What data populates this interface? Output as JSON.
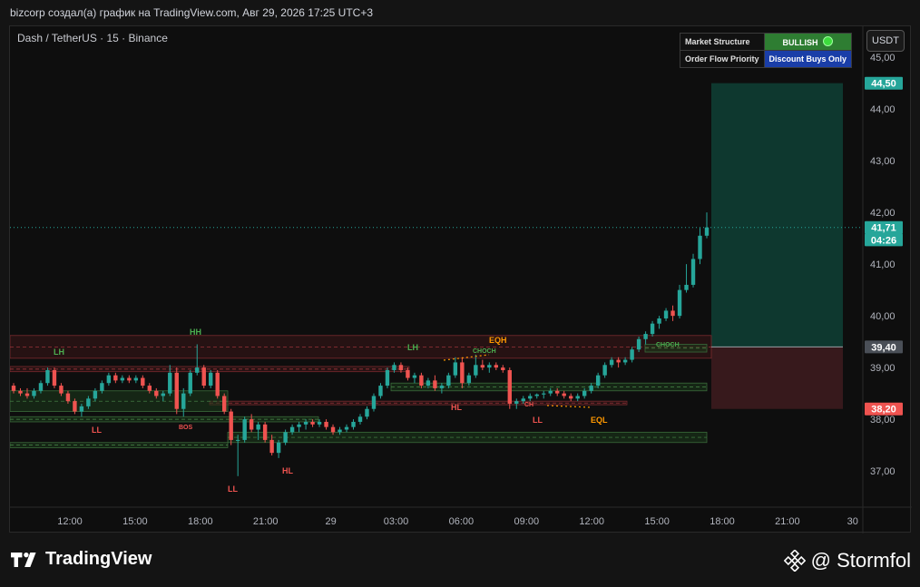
{
  "header": {
    "publish_line": "bizcorp создал(а) график на TradingView.com, Авг 29, 2026 17:25 UTC+3"
  },
  "chart": {
    "symbol_line": "Dash / TetherUS · 15 · Binance",
    "currency_button": "USDT",
    "market_structure": {
      "label": "Market Structure",
      "value": "BULLISH",
      "flow_label": "Order Flow Priority",
      "flow_value": "Discount Buys Only"
    },
    "colors": {
      "up": "#26a69a",
      "down": "#ef5350",
      "target_zone": "#0f3b32",
      "stop_zone": "#3a1a1e",
      "bull_zone": "#1b3a1b",
      "bear_zone": "#3a1518"
    }
  },
  "chart_data": {
    "type": "candlestick",
    "y_axis": {
      "ylim": [
        36.3,
        45.6
      ],
      "tick_labels": [
        "45,00",
        "44,00",
        "43,00",
        "42,00",
        "41,00",
        "40,00",
        "39,00",
        "38,00",
        "37,00"
      ],
      "tick_values": [
        45,
        44,
        43,
        42,
        41,
        40,
        39,
        38,
        37
      ]
    },
    "x_axis": {
      "tick_labels": [
        "12:00",
        "15:00",
        "18:00",
        "21:00",
        "29",
        "03:00",
        "06:00",
        "09:00",
        "12:00",
        "15:00",
        "18:00",
        "21:00",
        "30"
      ]
    },
    "price_labels": [
      {
        "text": "44,50",
        "value": 44.5,
        "kind": "target"
      },
      {
        "text": "41,71",
        "value": 41.71,
        "kind": "last"
      },
      {
        "text": "04:26",
        "value": 41.47,
        "kind": "countdown"
      },
      {
        "text": "39,40",
        "value": 39.4,
        "kind": "entry"
      },
      {
        "text": "38,20",
        "value": 38.2,
        "kind": "stop"
      }
    ],
    "structure_labels": [
      {
        "text": "LH",
        "kind": "bull"
      },
      {
        "text": "HH",
        "kind": "bull"
      },
      {
        "text": "LL",
        "kind": "bear"
      },
      {
        "text": "BOS",
        "kind": "bear"
      },
      {
        "text": "LL",
        "kind": "bear"
      },
      {
        "text": "HL",
        "kind": "bear"
      },
      {
        "text": "LH",
        "kind": "bull"
      },
      {
        "text": "CHOCH",
        "kind": "bull"
      },
      {
        "text": "EQH",
        "kind": "eq"
      },
      {
        "text": "HL",
        "kind": "bear"
      },
      {
        "text": "CH",
        "kind": "bear"
      },
      {
        "text": "LL",
        "kind": "bear"
      },
      {
        "text": "EQL",
        "kind": "eq"
      },
      {
        "text": "CHOCH",
        "kind": "bull"
      }
    ],
    "candles": [
      [
        38.65,
        38.7,
        38.5,
        38.55
      ],
      [
        38.55,
        38.6,
        38.45,
        38.5
      ],
      [
        38.5,
        38.6,
        38.4,
        38.45
      ],
      [
        38.45,
        38.6,
        38.4,
        38.55
      ],
      [
        38.55,
        38.75,
        38.5,
        38.7
      ],
      [
        38.7,
        39.0,
        38.65,
        38.95
      ],
      [
        38.95,
        39.0,
        38.6,
        38.65
      ],
      [
        38.65,
        38.7,
        38.45,
        38.5
      ],
      [
        38.5,
        38.55,
        38.3,
        38.35
      ],
      [
        38.35,
        38.4,
        38.1,
        38.15
      ],
      [
        38.15,
        38.3,
        38.05,
        38.25
      ],
      [
        38.25,
        38.45,
        38.2,
        38.4
      ],
      [
        38.4,
        38.6,
        38.35,
        38.55
      ],
      [
        38.55,
        38.75,
        38.5,
        38.7
      ],
      [
        38.7,
        38.9,
        38.65,
        38.85
      ],
      [
        38.85,
        38.9,
        38.7,
        38.75
      ],
      [
        38.75,
        38.85,
        38.7,
        38.8
      ],
      [
        38.8,
        38.85,
        38.7,
        38.75
      ],
      [
        38.75,
        38.85,
        38.7,
        38.8
      ],
      [
        38.8,
        38.85,
        38.6,
        38.65
      ],
      [
        38.65,
        38.7,
        38.5,
        38.55
      ],
      [
        38.55,
        38.6,
        38.4,
        38.45
      ],
      [
        38.45,
        38.55,
        38.35,
        38.5
      ],
      [
        38.5,
        39.05,
        38.45,
        38.9
      ],
      [
        38.9,
        39.0,
        38.1,
        38.2
      ],
      [
        38.2,
        38.6,
        38.05,
        38.5
      ],
      [
        38.5,
        38.95,
        38.45,
        38.9
      ],
      [
        38.9,
        39.45,
        38.85,
        39.0
      ],
      [
        39.0,
        39.05,
        38.6,
        38.65
      ],
      [
        38.65,
        38.95,
        38.6,
        38.9
      ],
      [
        38.9,
        38.95,
        38.4,
        38.45
      ],
      [
        38.45,
        38.5,
        38.1,
        38.15
      ],
      [
        38.15,
        38.2,
        37.5,
        37.6
      ],
      [
        37.6,
        37.7,
        36.9,
        37.6
      ],
      [
        37.6,
        38.05,
        37.55,
        38.0
      ],
      [
        38.0,
        38.1,
        37.75,
        37.8
      ],
      [
        37.8,
        37.95,
        37.6,
        37.9
      ],
      [
        37.9,
        37.95,
        37.55,
        37.6
      ],
      [
        37.6,
        37.7,
        37.3,
        37.35
      ],
      [
        37.35,
        37.6,
        37.25,
        37.55
      ],
      [
        37.55,
        37.8,
        37.5,
        37.75
      ],
      [
        37.75,
        37.9,
        37.7,
        37.85
      ],
      [
        37.85,
        37.95,
        37.75,
        37.9
      ],
      [
        37.9,
        38.0,
        37.8,
        37.95
      ],
      [
        37.95,
        38.0,
        37.85,
        37.9
      ],
      [
        37.9,
        38.0,
        37.85,
        37.95
      ],
      [
        37.95,
        38.0,
        37.8,
        37.85
      ],
      [
        37.85,
        37.9,
        37.7,
        37.75
      ],
      [
        37.75,
        37.85,
        37.7,
        37.8
      ],
      [
        37.8,
        37.9,
        37.75,
        37.85
      ],
      [
        37.85,
        38.0,
        37.8,
        37.95
      ],
      [
        37.95,
        38.1,
        37.9,
        38.05
      ],
      [
        38.05,
        38.25,
        38.0,
        38.2
      ],
      [
        38.2,
        38.5,
        38.15,
        38.45
      ],
      [
        38.45,
        38.7,
        38.4,
        38.65
      ],
      [
        38.65,
        39.0,
        38.6,
        38.95
      ],
      [
        38.95,
        39.1,
        38.9,
        39.05
      ],
      [
        39.05,
        39.1,
        38.9,
        38.95
      ],
      [
        38.95,
        39.0,
        38.75,
        38.8
      ],
      [
        38.8,
        38.9,
        38.7,
        38.85
      ],
      [
        38.85,
        38.9,
        38.6,
        38.65
      ],
      [
        38.65,
        38.8,
        38.6,
        38.75
      ],
      [
        38.75,
        38.85,
        38.55,
        38.6
      ],
      [
        38.6,
        38.7,
        38.5,
        38.65
      ],
      [
        38.65,
        38.9,
        38.6,
        38.85
      ],
      [
        38.85,
        39.2,
        38.8,
        39.1
      ],
      [
        39.1,
        39.2,
        38.6,
        38.7
      ],
      [
        38.7,
        38.9,
        38.65,
        38.85
      ],
      [
        38.85,
        39.25,
        38.8,
        39.05
      ],
      [
        39.05,
        39.15,
        38.95,
        39.0
      ],
      [
        39.0,
        39.1,
        38.9,
        39.05
      ],
      [
        39.05,
        39.1,
        38.95,
        39.0
      ],
      [
        39.0,
        39.05,
        38.9,
        38.95
      ],
      [
        38.95,
        39.0,
        38.2,
        38.3
      ],
      [
        38.3,
        38.4,
        38.2,
        38.35
      ],
      [
        38.35,
        38.45,
        38.3,
        38.4
      ],
      [
        38.4,
        38.5,
        38.35,
        38.45
      ],
      [
        38.45,
        38.5,
        38.4,
        38.48
      ],
      [
        38.48,
        38.55,
        38.4,
        38.5
      ],
      [
        38.5,
        38.6,
        38.45,
        38.55
      ],
      [
        38.55,
        38.6,
        38.45,
        38.5
      ],
      [
        38.5,
        38.55,
        38.4,
        38.45
      ],
      [
        38.45,
        38.5,
        38.35,
        38.4
      ],
      [
        38.4,
        38.5,
        38.35,
        38.45
      ],
      [
        38.45,
        38.6,
        38.4,
        38.55
      ],
      [
        38.55,
        38.7,
        38.5,
        38.65
      ],
      [
        38.65,
        38.9,
        38.6,
        38.85
      ],
      [
        38.85,
        39.1,
        38.8,
        39.05
      ],
      [
        39.05,
        39.2,
        39.0,
        39.15
      ],
      [
        39.15,
        39.2,
        39.0,
        39.1
      ],
      [
        39.1,
        39.2,
        39.05,
        39.15
      ],
      [
        39.15,
        39.4,
        39.1,
        39.35
      ],
      [
        39.35,
        39.6,
        39.3,
        39.55
      ],
      [
        39.55,
        39.7,
        39.45,
        39.65
      ],
      [
        39.65,
        39.9,
        39.6,
        39.85
      ],
      [
        39.85,
        40.0,
        39.75,
        39.95
      ],
      [
        39.95,
        40.15,
        39.9,
        40.1
      ],
      [
        40.1,
        40.2,
        39.9,
        40.0
      ],
      [
        40.0,
        40.6,
        39.95,
        40.5
      ],
      [
        40.5,
        41.0,
        40.45,
        40.6
      ],
      [
        40.6,
        41.2,
        40.55,
        41.1
      ],
      [
        41.1,
        41.7,
        41.0,
        41.55
      ],
      [
        41.55,
        42.0,
        41.5,
        41.71
      ]
    ],
    "zones": [
      {
        "kind": "target",
        "top": 44.5,
        "bottom": 39.4
      },
      {
        "kind": "stop",
        "top": 39.4,
        "bottom": 38.2
      },
      {
        "kind": "bear",
        "top": 39.62,
        "bottom": 39.18
      },
      {
        "kind": "bear",
        "top": 39.02,
        "bottom": 38.92
      },
      {
        "kind": "bear",
        "top": 38.35,
        "bottom": 38.28
      },
      {
        "kind": "bull",
        "top": 38.55,
        "bottom": 38.15
      },
      {
        "kind": "bull",
        "top": 38.05,
        "bottom": 37.95
      },
      {
        "kind": "bull",
        "top": 37.75,
        "bottom": 37.55
      },
      {
        "kind": "bull",
        "top": 37.55,
        "bottom": 37.45
      },
      {
        "kind": "bull",
        "top": 38.7,
        "bottom": 38.55
      },
      {
        "kind": "bull",
        "top": 39.45,
        "bottom": 39.3
      }
    ]
  },
  "footer": {
    "brand": "TradingView",
    "author": "@ Stormfol"
  }
}
